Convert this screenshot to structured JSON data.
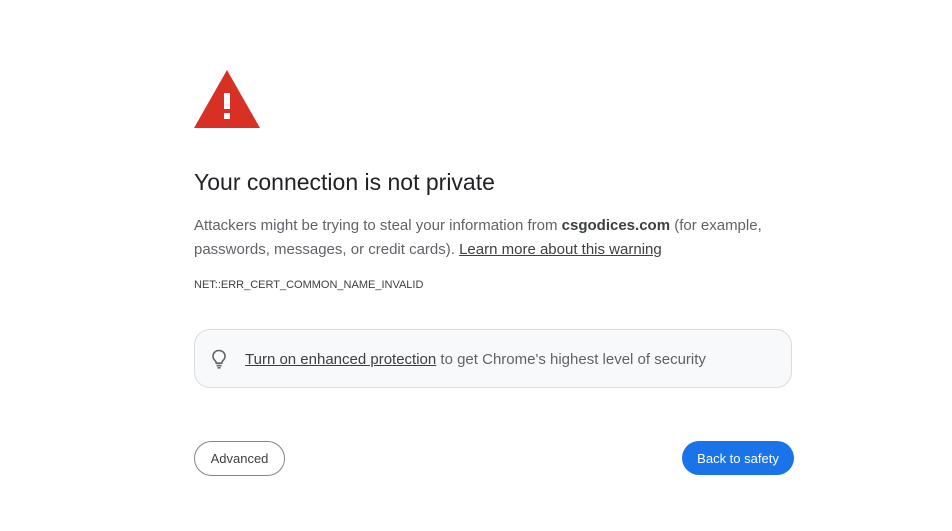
{
  "warning": {
    "icon": "warning-triangle-icon",
    "color": "#d93025"
  },
  "title": "Your connection is not private",
  "description": {
    "prefix": "Attackers might be trying to steal your information from ",
    "domain": "csgodices.com",
    "suffix": " (for example, passwords, messages, or credit cards). ",
    "learn_more_link": "Learn more about this warning"
  },
  "error_code": "NET::ERR_CERT_COMMON_NAME_INVALID",
  "protection_banner": {
    "icon": "lightbulb-icon",
    "link_text": "Turn on enhanced protection",
    "text": " to get Chrome's highest level of security"
  },
  "buttons": {
    "advanced_label": "Advanced",
    "back_label": "Back to safety",
    "back_color": "#1a73e8"
  }
}
